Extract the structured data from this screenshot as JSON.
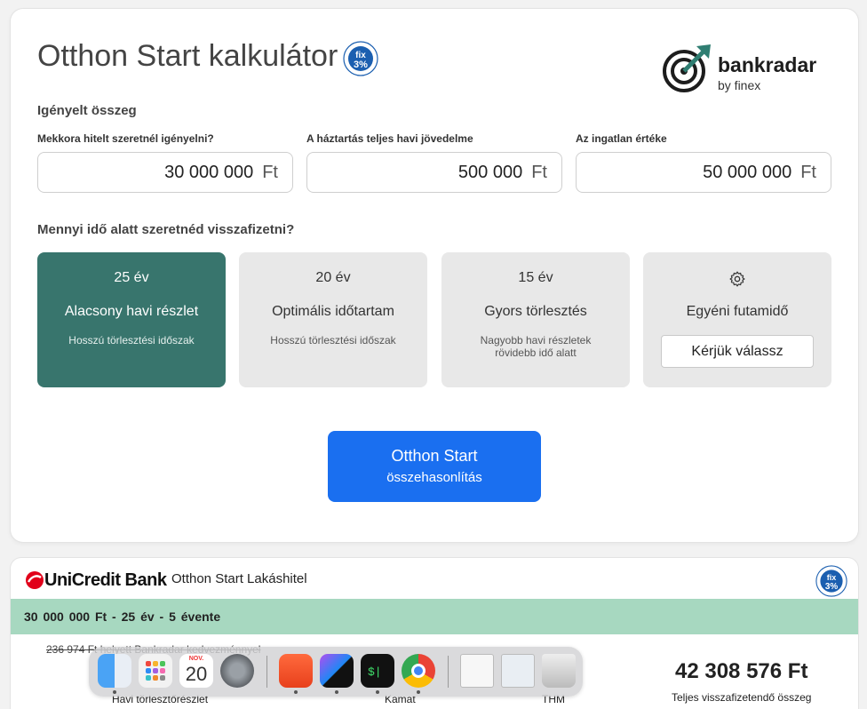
{
  "app": {
    "title": "Otthon Start kalkulátor",
    "brand_name": "bankradar",
    "brand_sub": "by finex",
    "fix_badge_text": "fix3%"
  },
  "amounts": {
    "section_title": "Igényelt összeg",
    "fields": [
      {
        "label": "Mekkora hitelt szeretnél igényelni?",
        "value": "30 000 000",
        "unit": "Ft"
      },
      {
        "label": "A háztartás teljes havi jövedelme",
        "value": "500 000",
        "unit": "Ft"
      },
      {
        "label": "Az ingatlan értéke",
        "value": "50 000 000",
        "unit": "Ft"
      }
    ]
  },
  "term": {
    "section_title": "Mennyi idő alatt szeretnéd visszafizetni?",
    "options": [
      {
        "years": "25 év",
        "title": "Alacsony havi részlet",
        "sub": "Hosszú törlesztési időszak",
        "sub2": ""
      },
      {
        "years": "20 év",
        "title": "Optimális időtartam",
        "sub": "Hosszú törlesztési időszak",
        "sub2": ""
      },
      {
        "years": "15 év",
        "title": "Gyors törlesztés",
        "sub": "Nagyobb havi részletek",
        "sub2": "rövidebb idő alatt"
      },
      {
        "years": "",
        "title": "Egyéni futamidő",
        "button": "Kérjük válassz"
      }
    ]
  },
  "cta": {
    "line1": "Otthon Start",
    "line2": "összehasonlítás"
  },
  "result": {
    "bank_name": "UniCredit Bank",
    "product": "Otthon Start Lakáshitel",
    "summary": "30 000 000 Ft   -   25 év   -   5 évente",
    "strikethrough": "236 974 Ft helyett Bankradar kedvezménnyel",
    "total": "42 308 576 Ft",
    "total_label": "Teljes visszafizetendő összeg",
    "col_labels": [
      "Havi törlesztőrészlet",
      "Kamat",
      "THM"
    ]
  },
  "dock": {
    "calendar_month": "NOV.",
    "calendar_day": "20",
    "apps": [
      "finder-icon",
      "launchpad-icon",
      "calendar-icon",
      "system-settings-icon",
      "brave-icon",
      "phpstorm-icon",
      "terminal-icon",
      "chrome-icon",
      "document-icon",
      "preview-icon",
      "trash-icon"
    ]
  },
  "colors": {
    "accent_green": "#38756d",
    "cta_blue": "#1a6ff0",
    "band_green": "#a7d8c0"
  }
}
